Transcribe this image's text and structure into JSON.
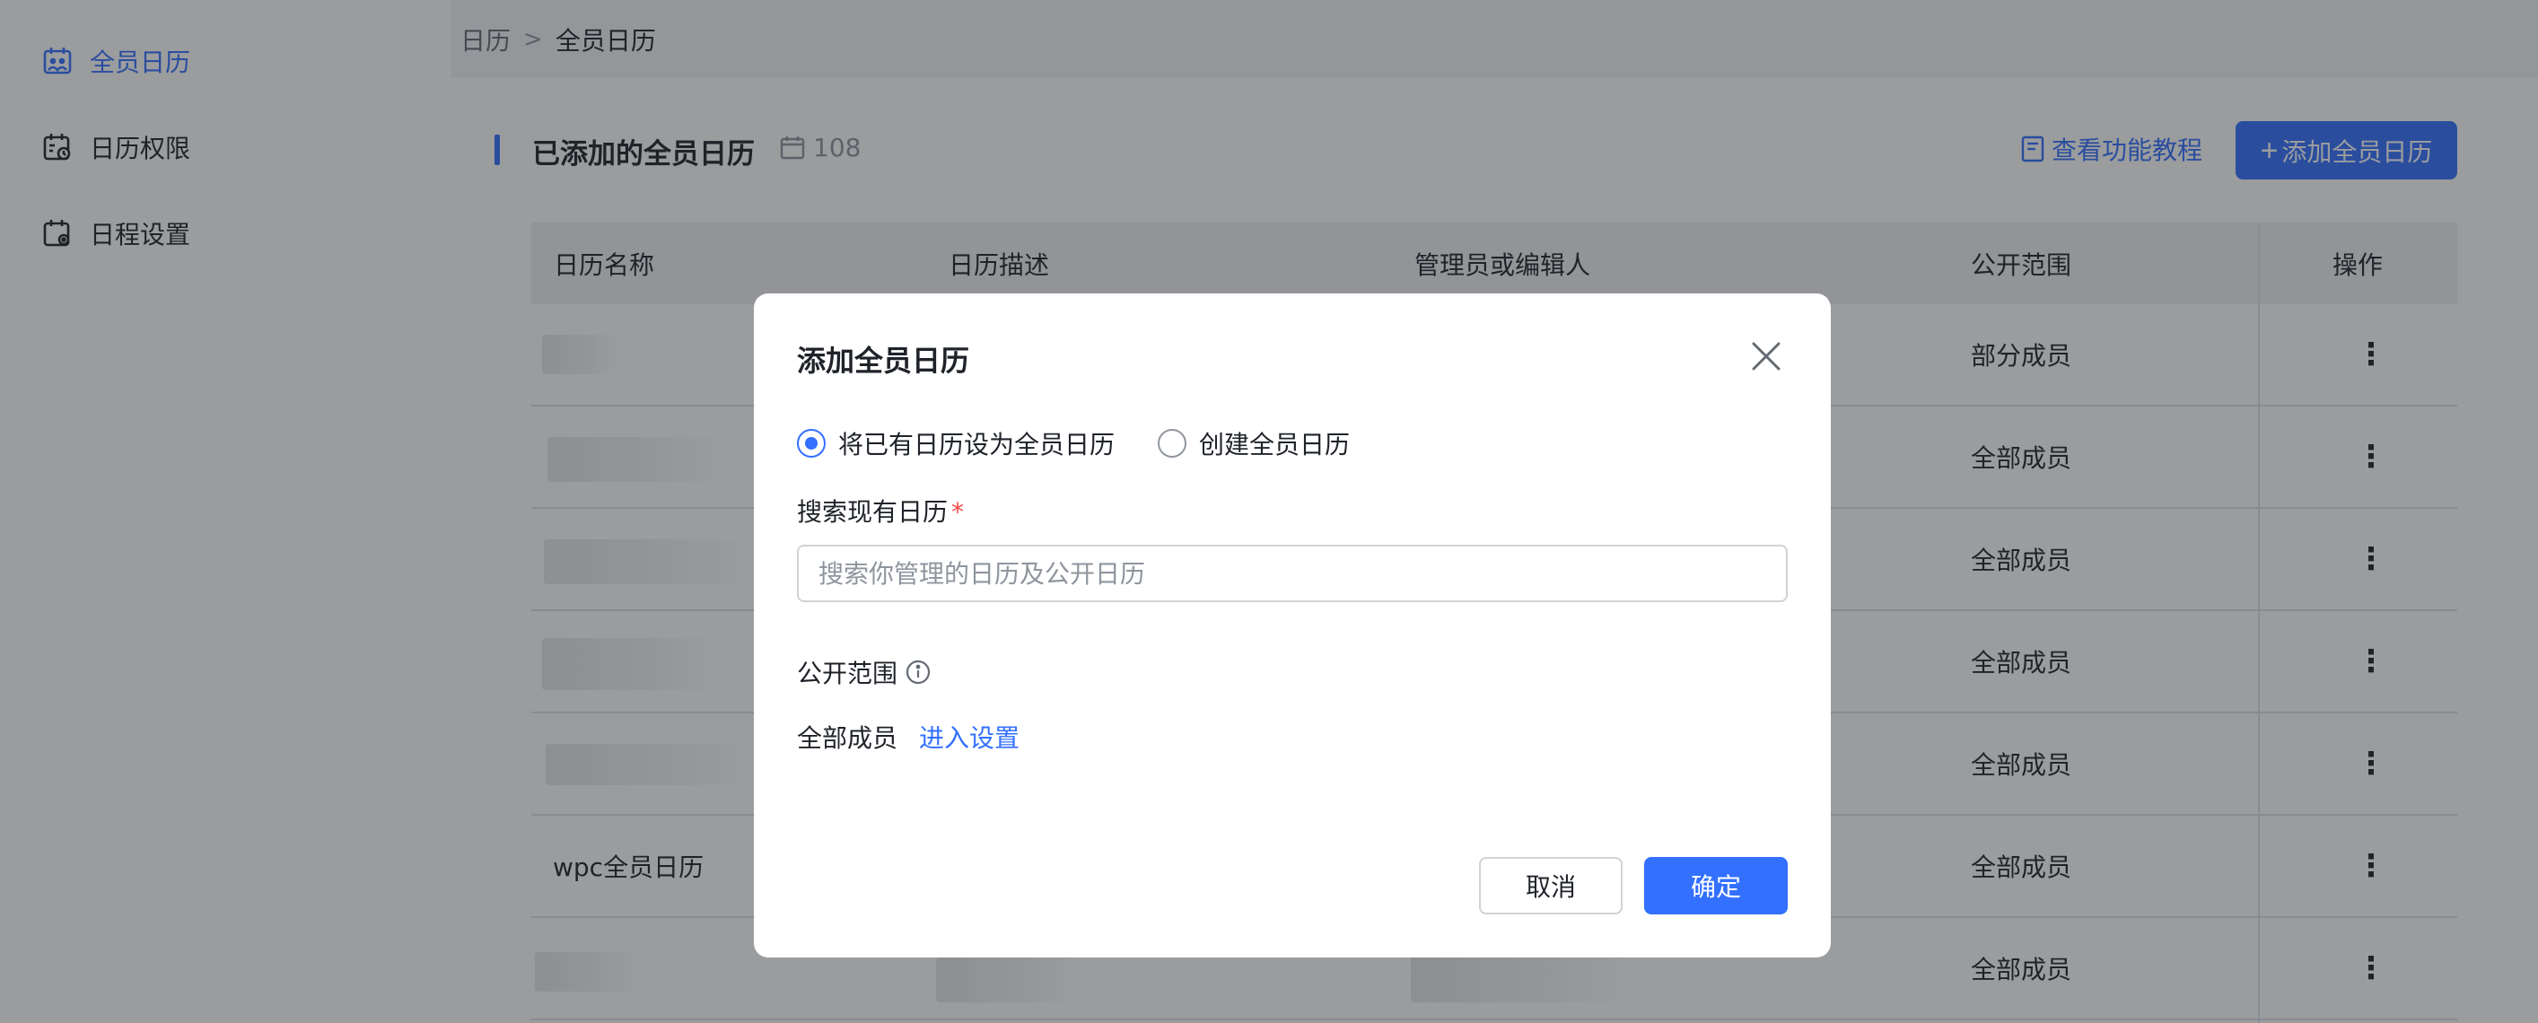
{
  "sidebar": {
    "items": [
      {
        "label": "全员日历",
        "icon": "calendar-people-icon",
        "active": true
      },
      {
        "label": "日历权限",
        "icon": "calendar-lock-icon",
        "active": false
      },
      {
        "label": "日程设置",
        "icon": "calendar-gear-icon",
        "active": false
      }
    ]
  },
  "breadcrumb": {
    "parent": "日历",
    "separator": ">",
    "current": "全员日历"
  },
  "header": {
    "title": "已添加的全员日历",
    "count": "108",
    "tutorial_label": "查看功能教程",
    "add_label": "添加全员日历",
    "add_prefix": "+"
  },
  "table": {
    "columns": [
      "日历名称",
      "日历描述",
      "管理员或编辑人",
      "公开范围",
      "操作"
    ],
    "rows": [
      {
        "name": "",
        "scope": "部分成员",
        "action": "⋮"
      },
      {
        "name": "",
        "scope": "全部成员",
        "action": "⋮"
      },
      {
        "name": "",
        "scope": "全部成员",
        "action": "⋮"
      },
      {
        "name": "",
        "scope": "全部成员",
        "action": "⋮"
      },
      {
        "name": "",
        "scope": "全部成员",
        "action": "⋮"
      },
      {
        "name": "wpc全员日历",
        "scope": "全部成员",
        "action": "⋮"
      },
      {
        "name": "",
        "scope": "全部成员",
        "action": "⋮"
      }
    ]
  },
  "dialog": {
    "title": "添加全员日历",
    "radio_options": [
      "将已有日历设为全员日历",
      "创建全员日历"
    ],
    "selected_option": "将已有日历设为全员日历",
    "search_label": "搜索现有日历",
    "required_mark": "*",
    "search_placeholder": "搜索你管理的日历及公开日历",
    "search_value": "",
    "scope_label": "公开范围",
    "scope_value": "全部成员",
    "scope_link": "进入设置",
    "cancel_label": "取消",
    "confirm_label": "确定"
  },
  "colors": {
    "accent": "#3370ff",
    "required": "#f54a45",
    "text": "#1f2329",
    "muted": "#8f959e"
  }
}
